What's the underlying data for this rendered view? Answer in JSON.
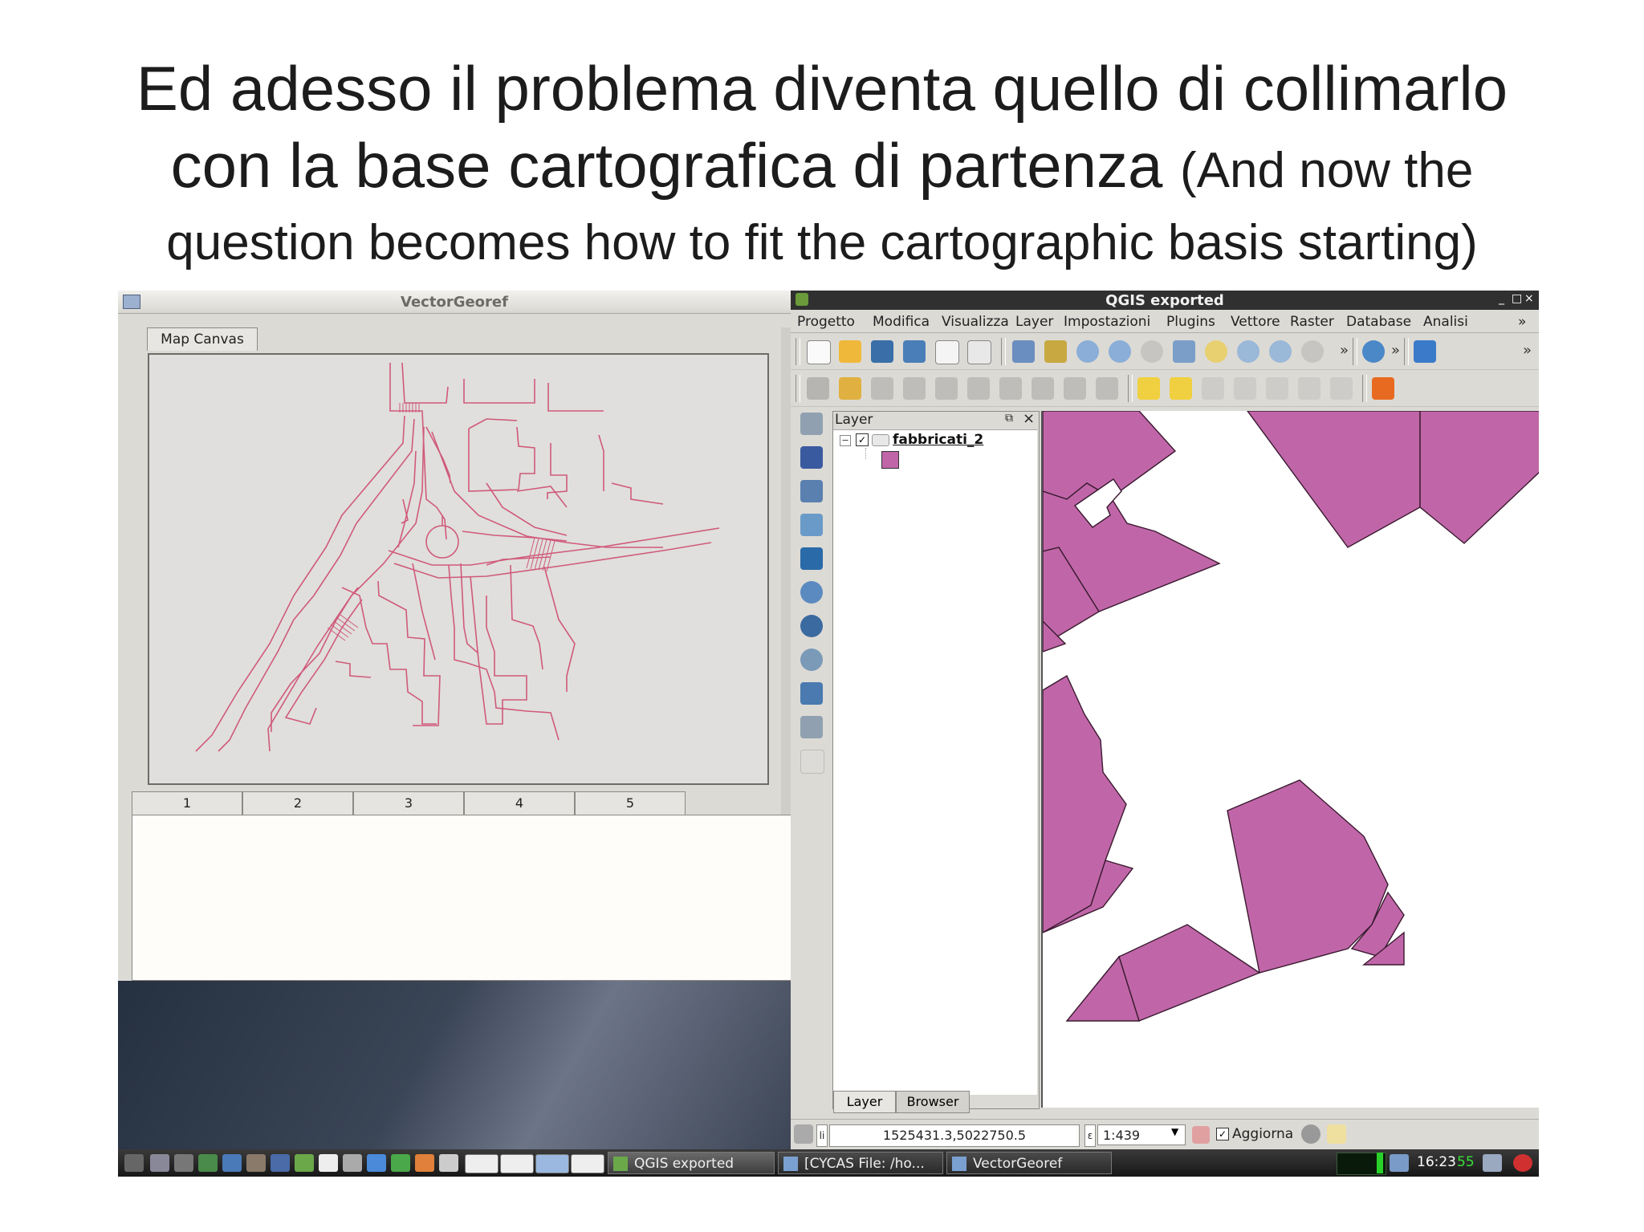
{
  "slide": {
    "title_line1": "Ed adesso il problema diventa quello di collimarlo",
    "title_line2": "con la base cartografica di partenza",
    "title_line2_en": "(And now the",
    "title_line3": "question becomes how to fit the cartographic basis starting)"
  },
  "vectorgeoref": {
    "window_title": "VectorGeoref",
    "tab_label": "Map Canvas",
    "columns": [
      "1",
      "2",
      "3",
      "4",
      "5"
    ],
    "line_color": "#d05a7a"
  },
  "qgis": {
    "window_title": "QGIS exported",
    "window_controls": [
      "_",
      "□",
      "×"
    ],
    "menu": [
      "Progetto",
      "Modifica",
      "Visualizza",
      "Layer",
      "Impostazioni",
      "Plugins",
      "Vettore",
      "Raster",
      "Database",
      "Analisi",
      "»"
    ],
    "layers_panel": {
      "title": "Layer",
      "layer_name": "fabbricati_2",
      "layer_checked": true,
      "swatch_color": "#c066a8",
      "tabs": [
        "Layer",
        "Browser"
      ]
    },
    "status": {
      "coordinates": "1525431.3,5022750.5",
      "scale": "1:439",
      "render_label": "Aggiorna",
      "render_checked": true
    },
    "polygon_fill": "#c066a8"
  },
  "taskbar": {
    "tasks": [
      "QGIS exported",
      "[CYCAS  File: /ho...",
      "VectorGeoref"
    ],
    "clock_time": "16:23",
    "clock_extra": "55"
  }
}
